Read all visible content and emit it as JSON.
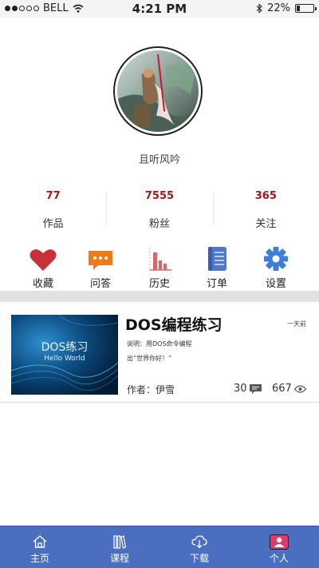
{
  "status_bar": {
    "carrier": "BELL",
    "time": "4:21 PM",
    "battery": "22%",
    "battery_level": 0.22
  },
  "profile": {
    "username": "且听风吟"
  },
  "stats": [
    {
      "value": "77",
      "label": "作品"
    },
    {
      "value": "7555",
      "label": "粉丝"
    },
    {
      "value": "365",
      "label": "关注"
    }
  ],
  "menu": [
    {
      "icon": "heart-icon",
      "label": "收藏",
      "color": "#c8303a"
    },
    {
      "icon": "chat-icon",
      "label": "问答",
      "color": "#f07a1a"
    },
    {
      "icon": "history-chart-icon",
      "label": "历史",
      "color": "#d9656c"
    },
    {
      "icon": "notebook-icon",
      "label": "订单",
      "color": "#4e78c8"
    },
    {
      "icon": "gear-icon",
      "label": "设置",
      "color": "#3d7fd6"
    }
  ],
  "course": {
    "thumb_title": "DOS练习",
    "thumb_subtitle": "Hello World",
    "title": "DOS编程练习",
    "time": "一天前",
    "desc_line1": "说明：用DOS命令编程",
    "desc_line2": "出“世界你好！”",
    "author": "作者：伊雪",
    "comments": "30",
    "views": "667"
  },
  "tabbar": [
    {
      "icon": "home-icon",
      "label": "主页"
    },
    {
      "icon": "books-icon",
      "label": "课程"
    },
    {
      "icon": "download-icon",
      "label": "下载"
    },
    {
      "icon": "person-icon",
      "label": "个人"
    }
  ],
  "colors": {
    "accent_red": "#a31818",
    "tabbar_blue": "#4a6fc0",
    "active_tab": "#e0396b"
  }
}
